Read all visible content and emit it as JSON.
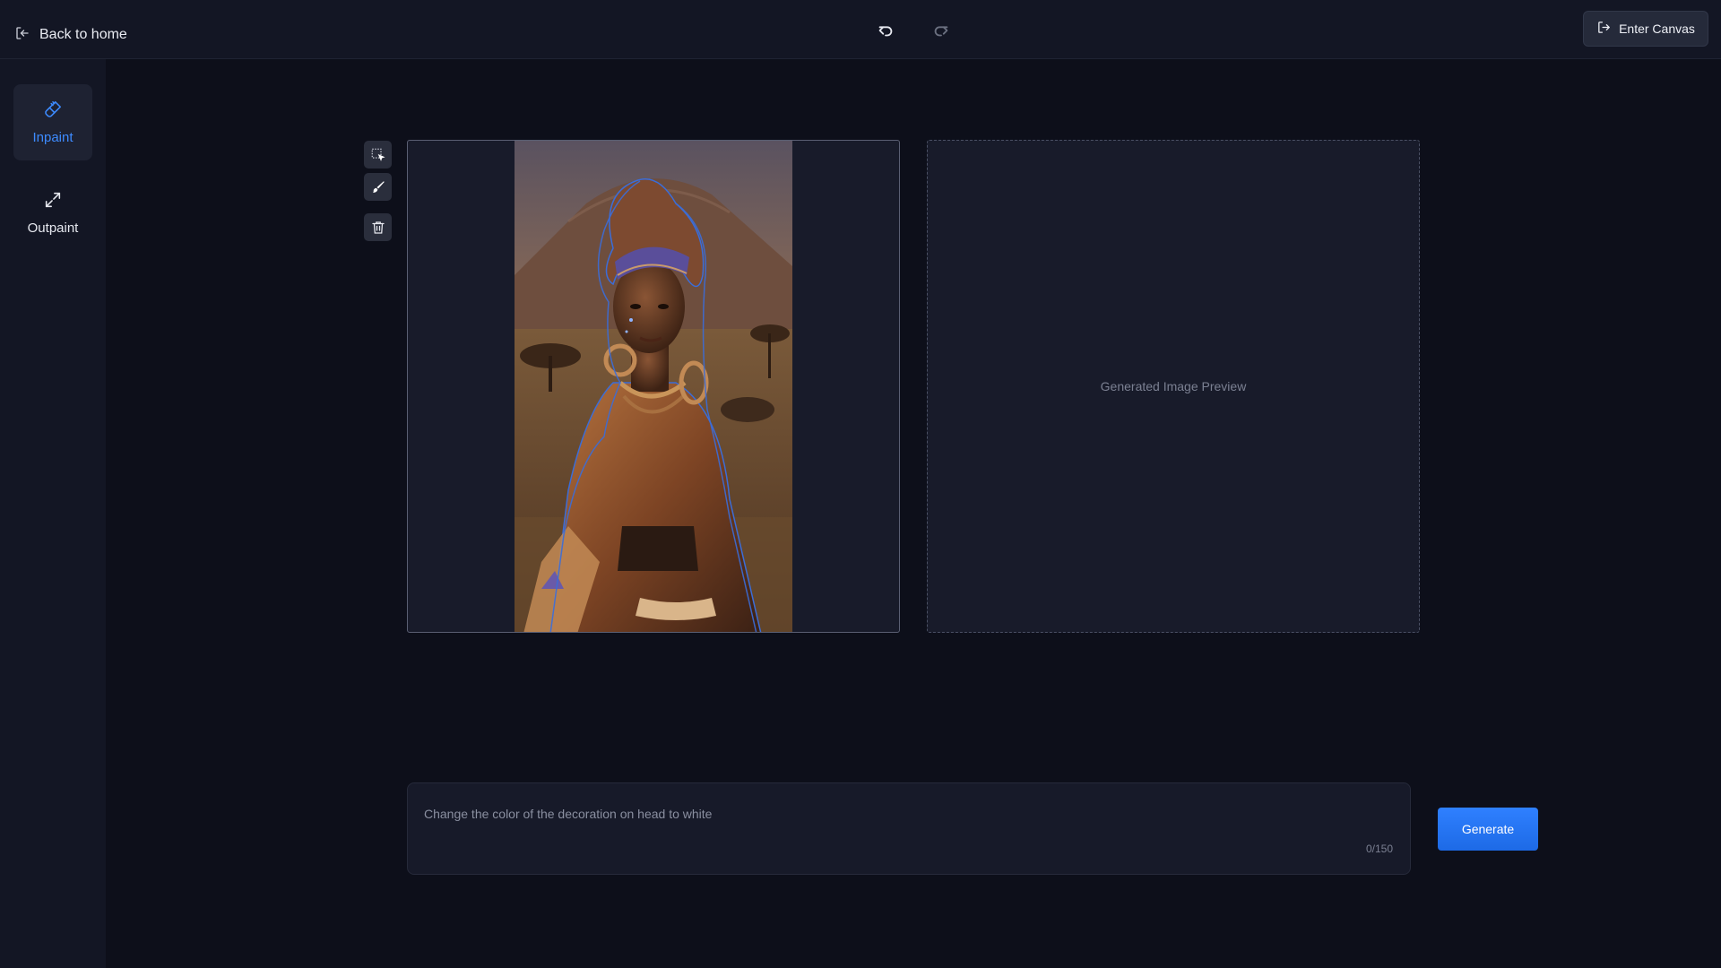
{
  "header": {
    "back_label": "Back to home",
    "enter_canvas_label": "Enter Canvas"
  },
  "sidebar": {
    "items": [
      {
        "label": "Inpaint",
        "icon": "brush-icon",
        "active": true
      },
      {
        "label": "Outpaint",
        "icon": "expand-icon",
        "active": false
      }
    ]
  },
  "tools": [
    "selection-icon",
    "brush-icon",
    "trash-icon"
  ],
  "preview": {
    "placeholder": "Generated Image Preview"
  },
  "prompt": {
    "placeholder": "Change the color of the decoration on head to white",
    "value": "",
    "counter": "0/150"
  },
  "generate_label": "Generate",
  "colors": {
    "accent": "#2f80ff",
    "background": "#0d0f1a",
    "panel": "#131624"
  }
}
